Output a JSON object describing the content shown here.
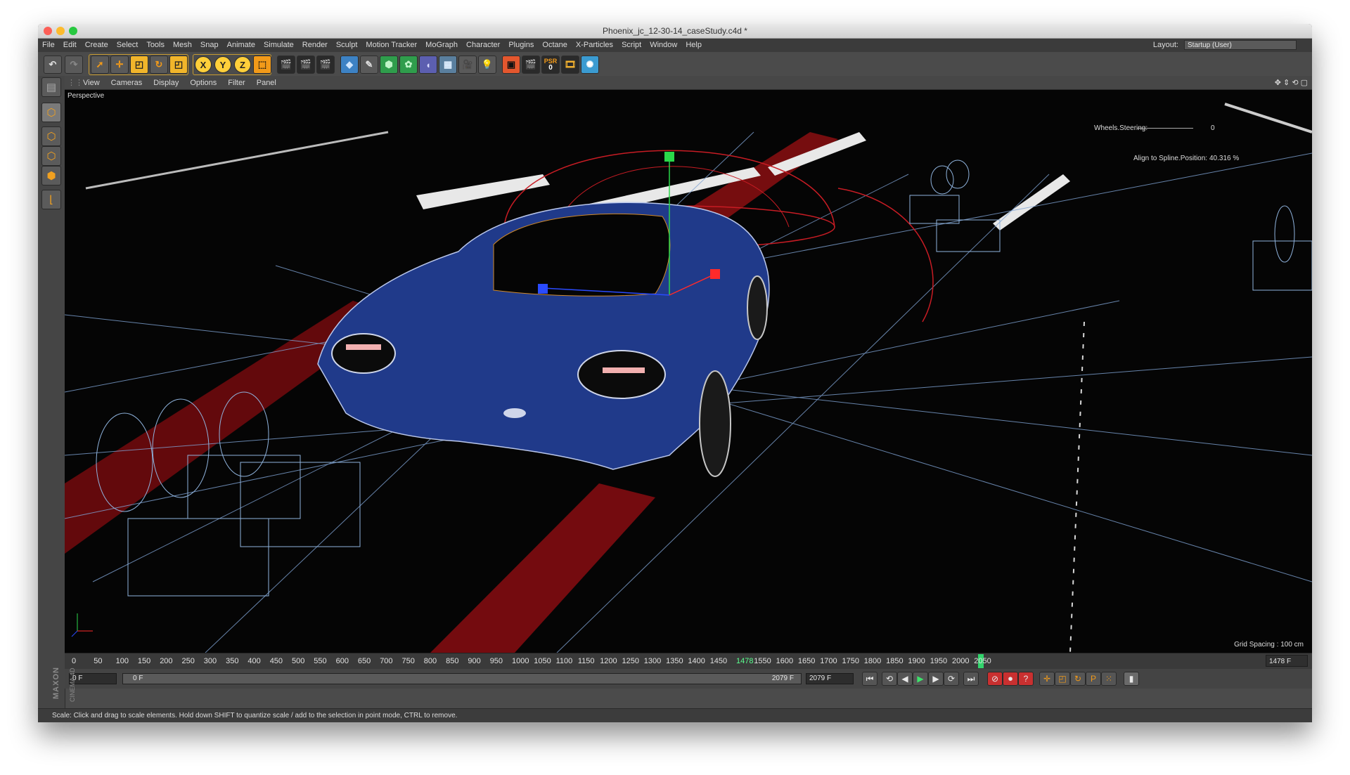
{
  "window": {
    "title": "Phoenix_jc_12-30-14_caseStudy.c4d *"
  },
  "menu": [
    "File",
    "Edit",
    "Create",
    "Select",
    "Tools",
    "Mesh",
    "Snap",
    "Animate",
    "Simulate",
    "Render",
    "Sculpt",
    "Motion Tracker",
    "MoGraph",
    "Character",
    "Plugins",
    "Octane",
    "X-Particles",
    "Script",
    "Window",
    "Help"
  ],
  "layout": {
    "label": "Layout:",
    "value": "Startup (User)"
  },
  "toolbar": {
    "axis_x": "X",
    "axis_y": "Y",
    "axis_z": "Z",
    "psr_label": "PSR",
    "psr_value": "0"
  },
  "viewport_menu": [
    "View",
    "Cameras",
    "Display",
    "Options",
    "Filter",
    "Panel"
  ],
  "viewport": {
    "camera_name": "Perspective",
    "hud_wheels_label": "Wheels.Steering:",
    "hud_wheels_value": "0",
    "hud_align_label": "Align to Spline.Position:",
    "hud_align_value": "40.316 %",
    "grid_spacing": "Grid Spacing : 100 cm"
  },
  "timeline": {
    "ticks": [
      "0",
      "50",
      "100",
      "150",
      "200",
      "250",
      "300",
      "350",
      "400",
      "450",
      "500",
      "550",
      "600",
      "650",
      "700",
      "750",
      "800",
      "850",
      "900",
      "950",
      "1000",
      "1050",
      "1100",
      "1150",
      "1200",
      "1250",
      "1300",
      "1350",
      "1400",
      "1450",
      "1478",
      "1550",
      "1600",
      "1650",
      "1700",
      "1750",
      "1800",
      "1850",
      "1900",
      "1950",
      "2000",
      "2050"
    ],
    "current_frame": "1478",
    "current_frame_field": "1478 F"
  },
  "playback": {
    "start_field": "0 F",
    "range_start": "0 F",
    "range_end": "2079 F",
    "end_field": "2079 F"
  },
  "status": "Scale: Click and drag to scale elements. Hold down SHIFT to quantize scale / add to the selection in point mode, CTRL to remove.",
  "brand": {
    "maxon": "MAXON",
    "product": "CINEMA 4D"
  },
  "colors": {
    "car_body": "#203a8a",
    "road_red": "#8b0f12",
    "wire_blue": "#7fa3d4",
    "selection_orange": "#f29a19"
  }
}
